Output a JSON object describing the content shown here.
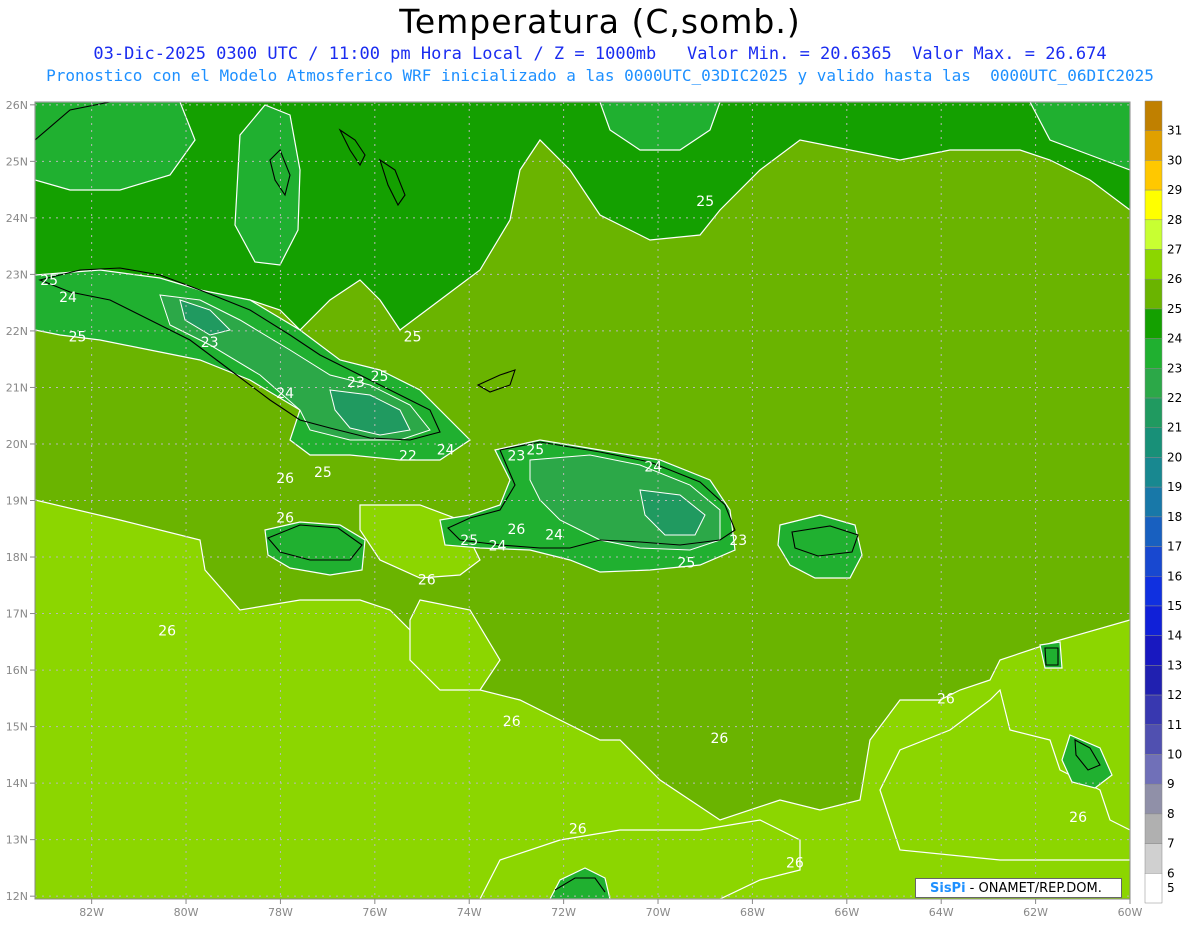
{
  "title": "Temperatura (C,somb.)",
  "subtitle_1": "03-Dic-2025 0300 UTC / 11:00 pm Hora Local / Z = 1000mb   Valor Min. = 20.6365  Valor Max. = 26.674",
  "subtitle_2": "Pronostico con el Modelo Atmosferico WRF inicializado a las 0000UTC_03DIC2025 y valido hasta las  0000UTC_06DIC2025",
  "lat_labels": [
    "26N",
    "25N",
    "24N",
    "23N",
    "22N",
    "21N",
    "20N",
    "19N",
    "18N",
    "17N",
    "16N",
    "15N",
    "14N",
    "13N",
    "12N"
  ],
  "lon_labels": [
    "82W",
    "80W",
    "78W",
    "76W",
    "74W",
    "72W",
    "70W",
    "68W",
    "66W",
    "64W",
    "62W",
    "60W"
  ],
  "colorbar": {
    "levels": [
      "31",
      "30",
      "29",
      "28",
      "27",
      "26",
      "25",
      "24",
      "23",
      "22",
      "21",
      "20",
      "19",
      "18",
      "17",
      "16",
      "15",
      "14",
      "13",
      "12",
      "11",
      "10",
      "9",
      "8",
      "7",
      "6",
      "5"
    ],
    "colors": [
      "#c08000",
      "#e0a000",
      "#ffc800",
      "#ffff00",
      "#c8ff32",
      "#8cd600",
      "#6ab400",
      "#14a000",
      "#20b030",
      "#2ca848",
      "#209a60",
      "#189078",
      "#188890",
      "#1878a8",
      "#1860c0",
      "#1848d0",
      "#1030e0",
      "#1020d8",
      "#1818c0",
      "#2020b0",
      "#3838b0",
      "#5050b0",
      "#7070b8",
      "#9090a8",
      "#b0b0b0",
      "#d0d0d0",
      "#ffffff"
    ]
  },
  "contour_labels": [
    {
      "text": "25",
      "lon": -82.9,
      "lat": 22.9
    },
    {
      "text": "24",
      "lon": -82.5,
      "lat": 22.6
    },
    {
      "text": "25",
      "lon": -82.3,
      "lat": 21.9
    },
    {
      "text": "23",
      "lon": -79.5,
      "lat": 21.8
    },
    {
      "text": "24",
      "lon": -77.9,
      "lat": 20.9
    },
    {
      "text": "23",
      "lon": -76.4,
      "lat": 21.1
    },
    {
      "text": "25",
      "lon": -75.9,
      "lat": 21.2
    },
    {
      "text": "25",
      "lon": -75.2,
      "lat": 21.9
    },
    {
      "text": "24",
      "lon": -74.5,
      "lat": 19.9
    },
    {
      "text": "22",
      "lon": -75.3,
      "lat": 19.8
    },
    {
      "text": "25",
      "lon": -77.1,
      "lat": 19.5
    },
    {
      "text": "26",
      "lon": -77.9,
      "lat": 19.4
    },
    {
      "text": "25",
      "lon": -72.6,
      "lat": 19.9
    },
    {
      "text": "23",
      "lon": -73.0,
      "lat": 19.8
    },
    {
      "text": "24",
      "lon": -70.1,
      "lat": 19.6
    },
    {
      "text": "26",
      "lon": -77.9,
      "lat": 18.7
    },
    {
      "text": "26",
      "lon": -73.0,
      "lat": 18.5
    },
    {
      "text": "24",
      "lon": -72.2,
      "lat": 18.4
    },
    {
      "text": "25",
      "lon": -74.0,
      "lat": 18.3
    },
    {
      "text": "24",
      "lon": -73.4,
      "lat": 18.2
    },
    {
      "text": "23",
      "lon": -68.3,
      "lat": 18.3
    },
    {
      "text": "25",
      "lon": -69.4,
      "lat": 17.9
    },
    {
      "text": "26",
      "lon": -74.9,
      "lat": 17.6
    },
    {
      "text": "26",
      "lon": -80.4,
      "lat": 16.7
    },
    {
      "text": "25",
      "lon": -69.0,
      "lat": 24.3
    },
    {
      "text": "26",
      "lon": -63.9,
      "lat": 15.5
    },
    {
      "text": "26",
      "lon": -73.1,
      "lat": 15.1
    },
    {
      "text": "26",
      "lon": -68.7,
      "lat": 14.8
    },
    {
      "text": "26",
      "lon": -71.7,
      "lat": 13.2
    },
    {
      "text": "26",
      "lon": -67.1,
      "lat": 12.6
    },
    {
      "text": "26",
      "lon": -61.1,
      "lat": 13.4
    }
  ],
  "credit": {
    "brand": "SisPi",
    "rest": " - ONAMET/REP.DOM."
  },
  "field_colors": {
    "light": "#8cd600",
    "mid": "#6ab400",
    "dark": "#14a000",
    "green24": "#20b030",
    "green23": "#2ca848",
    "green22": "#209a60"
  }
}
